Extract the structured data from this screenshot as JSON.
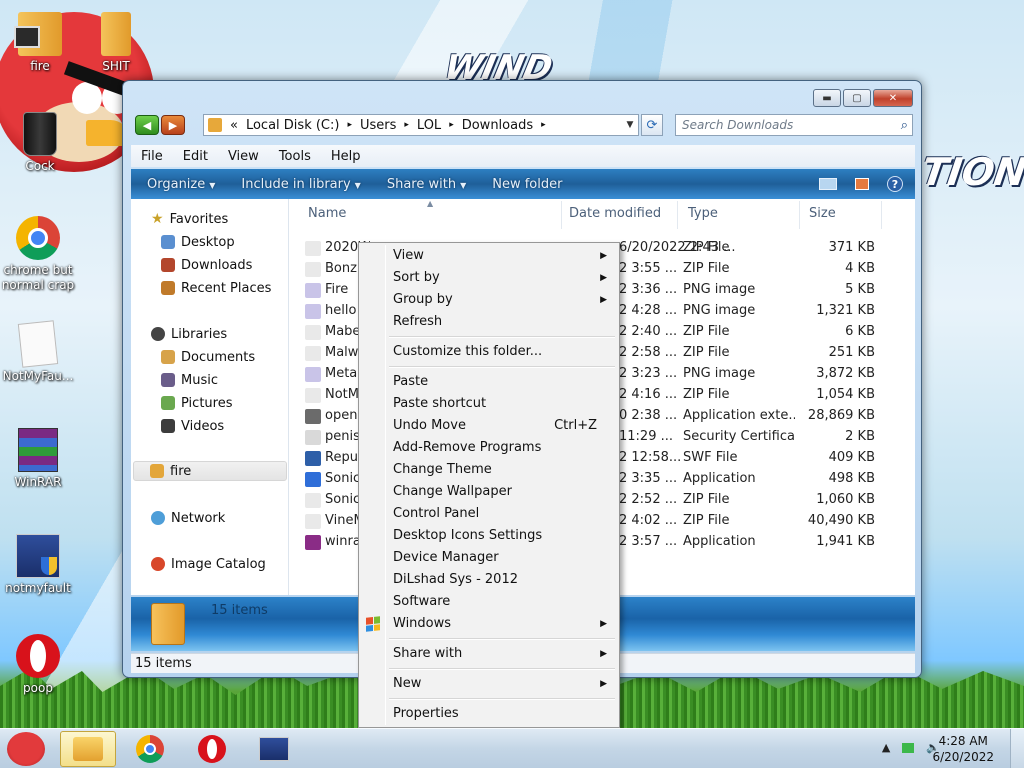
{
  "desktop": {
    "brand_left": "WIND",
    "brand_right": "TION",
    "icons": [
      {
        "label": "fire",
        "icon": "folder-icon"
      },
      {
        "label": "SHIT",
        "icon": "folder-icon"
      },
      {
        "label": "Cock",
        "icon": "recycle-bin-icon"
      },
      {
        "label": "chrome but normal crap",
        "icon": "chrome-icon"
      },
      {
        "label": "NotMyFau...",
        "icon": "file-icon"
      },
      {
        "label": "WinRAR",
        "icon": "winrar-icon"
      },
      {
        "label": "notmyfault",
        "icon": "app-icon"
      },
      {
        "label": "poop",
        "icon": "opera-icon"
      }
    ]
  },
  "window": {
    "address": {
      "segments": [
        "«",
        "Local Disk (C:)",
        "Users",
        "LOL",
        "Downloads"
      ],
      "separator": "▸"
    },
    "search_placeholder": "Search Downloads",
    "menu": [
      "File",
      "Edit",
      "View",
      "Tools",
      "Help"
    ],
    "commands": [
      "Organize",
      "Include in library",
      "Share with",
      "New folder"
    ],
    "nav": {
      "favorites_header": "Favorites",
      "favorites": [
        "Desktop",
        "Downloads",
        "Recent Places"
      ],
      "libraries_header": "Libraries",
      "libraries": [
        "Documents",
        "Music",
        "Pictures",
        "Videos"
      ],
      "selected": "fire",
      "network": "Network",
      "image_catalog": "Image Catalog"
    },
    "columns": {
      "name": "Name",
      "date": "Date modified",
      "type": "Type",
      "size": "Size"
    },
    "files": [
      {
        "name": "2020Windows8.1NoSleep.zip",
        "date": "6/20/2022 2:43 ...",
        "type": "ZIP File",
        "size": "371 KB",
        "color": "#e9e9e9"
      },
      {
        "name": "Bonz",
        "date": "2 3:55 ...",
        "type": "ZIP File",
        "size": "4 KB",
        "color": "#e9e9e9"
      },
      {
        "name": "Fire",
        "date": "2 3:36 ...",
        "type": "PNG image",
        "size": "5 KB",
        "color": "#c9c4e8"
      },
      {
        "name": "hello",
        "date": "2 4:28 ...",
        "type": "PNG image",
        "size": "1,321 KB",
        "color": "#c9c4e8"
      },
      {
        "name": "Mabe",
        "date": "2 2:40 ...",
        "type": "ZIP File",
        "size": "6 KB",
        "color": "#e9e9e9"
      },
      {
        "name": "Malw",
        "date": "2 2:58 ...",
        "type": "ZIP File",
        "size": "251 KB",
        "color": "#e9e9e9"
      },
      {
        "name": "Meta",
        "date": "2 3:23 ...",
        "type": "PNG image",
        "size": "3,872 KB",
        "color": "#c9c4e8"
      },
      {
        "name": "NotM",
        "date": "2 4:16 ...",
        "type": "ZIP File",
        "size": "1,054 KB",
        "color": "#e9e9e9"
      },
      {
        "name": "open",
        "date": "0 2:38 ...",
        "type": "Application exte...",
        "size": "28,869 KB",
        "color": "#6b6b6b"
      },
      {
        "name": "penis",
        "date": "11:29 ...",
        "type": "Security Certifica...",
        "size": "2 KB",
        "color": "#d9d9d9"
      },
      {
        "name": "Repu",
        "date": "2 12:58...",
        "type": "SWF File",
        "size": "409 KB",
        "color": "#2e5fa8"
      },
      {
        "name": "Sonic",
        "date": "2 3:35 ...",
        "type": "Application",
        "size": "498 KB",
        "color": "#2f6ed8"
      },
      {
        "name": "Sonic",
        "date": "2 2:52 ...",
        "type": "ZIP File",
        "size": "1,060 KB",
        "color": "#e9e9e9"
      },
      {
        "name": "VineM",
        "date": "2 4:02 ...",
        "type": "ZIP File",
        "size": "40,490 KB",
        "color": "#e9e9e9"
      },
      {
        "name": "winra",
        "date": "2 3:57 ...",
        "type": "Application",
        "size": "1,941 KB",
        "color": "#8a2c86"
      }
    ],
    "details_text": "15 items",
    "status_text": "15 items"
  },
  "context_menu": {
    "groups": [
      [
        {
          "label": "View",
          "submenu": true
        },
        {
          "label": "Sort by",
          "submenu": true
        },
        {
          "label": "Group by",
          "submenu": true
        },
        {
          "label": "Refresh",
          "submenu": false
        }
      ],
      [
        {
          "label": "Customize this folder...",
          "submenu": false
        }
      ],
      [
        {
          "label": "Paste",
          "submenu": false
        },
        {
          "label": "Paste shortcut",
          "submenu": false
        },
        {
          "label": "Undo Move",
          "submenu": false,
          "shortcut": "Ctrl+Z"
        },
        {
          "label": "Add-Remove Programs",
          "submenu": false
        },
        {
          "label": "Change Theme",
          "submenu": false
        },
        {
          "label": "Change Wallpaper",
          "submenu": false
        },
        {
          "label": "Control Panel",
          "submenu": false
        },
        {
          "label": "Desktop Icons Settings",
          "submenu": false
        },
        {
          "label": "Device Manager",
          "submenu": false
        },
        {
          "label": "DiLshad Sys - 2012",
          "submenu": false
        },
        {
          "label": "Software",
          "submenu": false
        },
        {
          "label": "Windows",
          "submenu": true,
          "icon": "windows-flag-icon"
        }
      ],
      [
        {
          "label": "Share with",
          "submenu": true
        }
      ],
      [
        {
          "label": "New",
          "submenu": true
        }
      ],
      [
        {
          "label": "Properties",
          "submenu": false
        }
      ]
    ]
  },
  "taskbar": {
    "start_icon": "angry-bird-start-icon",
    "pinned": [
      "explorer-icon",
      "chrome-icon",
      "opera-icon",
      "app-icon"
    ],
    "time": "4:28 AM",
    "date": "6/20/2022"
  }
}
